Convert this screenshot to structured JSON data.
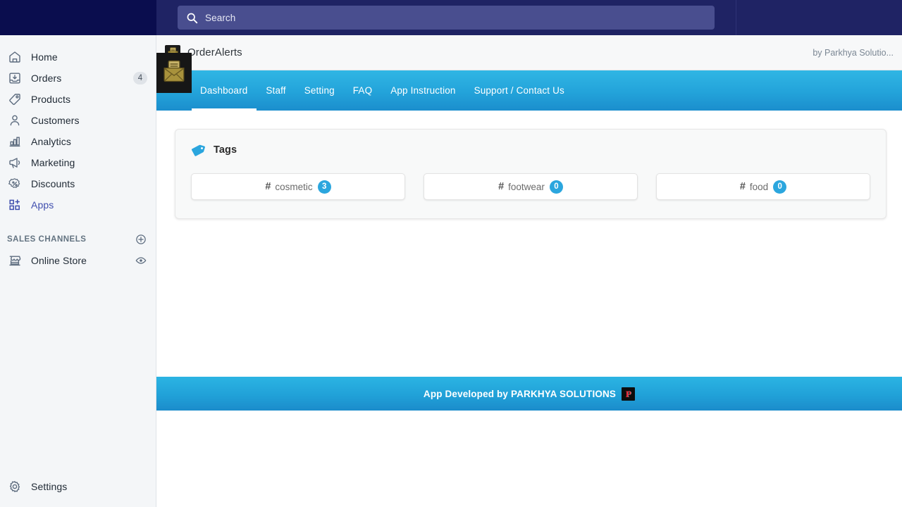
{
  "topbar": {
    "search": {
      "placeholder": "Search",
      "icon": "search-icon"
    }
  },
  "sidebar": {
    "items": [
      {
        "label": "Home",
        "icon": "home-icon",
        "badge": "",
        "active": false
      },
      {
        "label": "Orders",
        "icon": "orders-icon",
        "badge": "4",
        "active": false
      },
      {
        "label": "Products",
        "icon": "products-icon",
        "badge": "",
        "active": false
      },
      {
        "label": "Customers",
        "icon": "customers-icon",
        "badge": "",
        "active": false
      },
      {
        "label": "Analytics",
        "icon": "analytics-icon",
        "badge": "",
        "active": false
      },
      {
        "label": "Marketing",
        "icon": "marketing-icon",
        "badge": "",
        "active": false
      },
      {
        "label": "Discounts",
        "icon": "discounts-icon",
        "badge": "",
        "active": false
      },
      {
        "label": "Apps",
        "icon": "apps-icon",
        "badge": "",
        "active": true
      }
    ],
    "sales_channels": {
      "title": "SALES CHANNELS",
      "add_icon": "plus-circle-icon",
      "items": [
        {
          "label": "Online Store",
          "icon": "store-icon",
          "action_icon": "eye-icon"
        }
      ]
    },
    "settings": {
      "label": "Settings",
      "icon": "gear-icon"
    }
  },
  "app_header": {
    "title": "OrderAlerts",
    "logo_icon": "envelope-document-icon",
    "developer": "by Parkhya Solutio..."
  },
  "navbar": {
    "logo_icon": "envelope-document-icon",
    "tabs": [
      {
        "label": "Dashboard",
        "active": true
      },
      {
        "label": "Staff",
        "active": false
      },
      {
        "label": "Setting",
        "active": false
      },
      {
        "label": "FAQ",
        "active": false
      },
      {
        "label": "App Instruction",
        "active": false
      },
      {
        "label": "Support / Contact Us",
        "active": false
      }
    ]
  },
  "tags_card": {
    "title": "Tags",
    "icon": "tag-icon",
    "chips": [
      {
        "hash": "#",
        "name": "cosmetic",
        "count": "3"
      },
      {
        "hash": "#",
        "name": "footwear",
        "count": "0"
      },
      {
        "hash": "#",
        "name": "food",
        "count": "0"
      }
    ]
  },
  "footer": {
    "text": "App Developed by PARKHYA SOLUTIONS",
    "logo_letter": "P"
  },
  "colors": {
    "topbar_bg": "#1f2364",
    "topbar_left_bg": "#0a0d4e",
    "search_bg": "#494e8f",
    "sidebar_bg": "#f4f6f8",
    "accent_blue": "#2ba6de",
    "nav_gradient_top": "#30b6e4",
    "nav_gradient_bottom": "#1b8ecd",
    "active_link": "#3f4eae",
    "logo_gold": "#b09b40"
  }
}
